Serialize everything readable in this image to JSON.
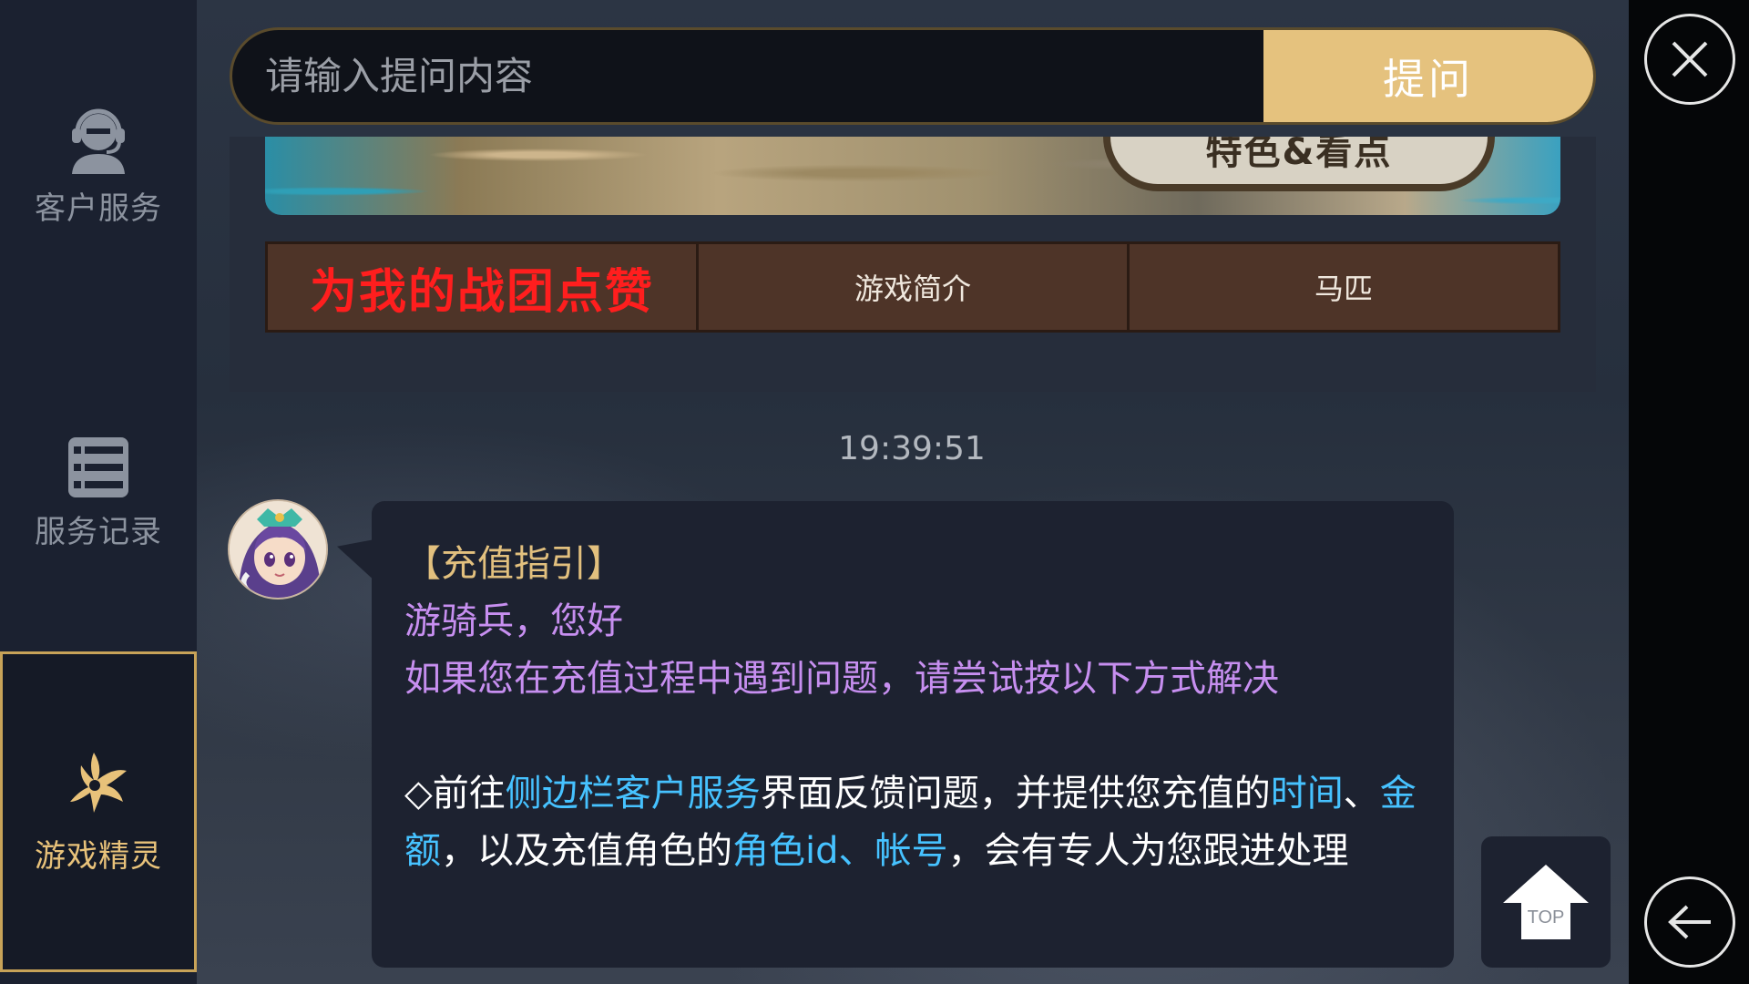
{
  "search": {
    "placeholder": "请输入提问内容",
    "ask_label": "提问"
  },
  "sidebar": {
    "items": [
      {
        "label": "客户服务",
        "icon": "headset-agent-icon"
      },
      {
        "label": "服务记录",
        "icon": "list-icon"
      },
      {
        "label": "游戏精灵",
        "icon": "fairy-icon",
        "active": true
      }
    ]
  },
  "banner": {
    "plaque_text": "特色&看点"
  },
  "tabs": [
    {
      "label": "为我的战团点赞"
    },
    {
      "label": "游戏简介"
    },
    {
      "label": "马匹"
    }
  ],
  "timestamp": "19:39:51",
  "message": {
    "title": "【充值指引】",
    "greeting": "游骑兵，您好",
    "intro": "如果您在充值过程中遇到问题，请尝试按以下方式解决",
    "p1": "◇前往",
    "p2": "侧边栏客户服务",
    "p3": "界面反馈问题，并提供您充值的",
    "p4": "时间",
    "p5": "、",
    "p6": "金额",
    "p7": "，以及充值角色的",
    "p8": "角色id、帐号",
    "p9": "，会有专人为您跟进处理"
  },
  "top_button": {
    "label": "TOP"
  },
  "colors": {
    "accent_gold": "#e5c27e",
    "sidebar_active_border": "#c8a358",
    "highlight_red": "#ff1e1e",
    "text_purple": "#c78ff0",
    "text_blue": "#46c2ff"
  }
}
